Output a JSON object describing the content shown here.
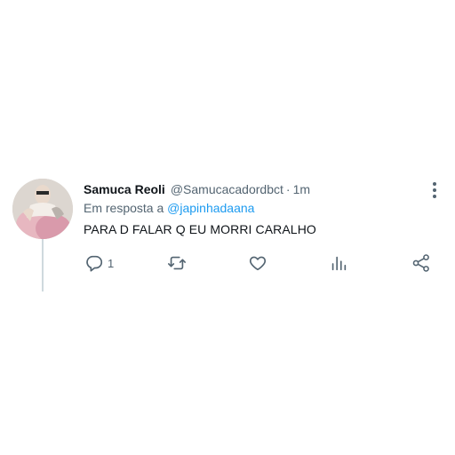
{
  "tweet": {
    "author": {
      "display_name": "Samuca Reoli",
      "handle": "@Samucacadordbct",
      "separator": "·",
      "timestamp": "1m",
      "avatar_icon": "profile-photo"
    },
    "reply_to": {
      "prefix": "Em resposta a",
      "mention": "@japinhadaana"
    },
    "text": "PARA D FALAR Q EU MORRI CARALHO",
    "actions": {
      "reply": {
        "icon": "reply-icon",
        "count": "1"
      },
      "retweet": {
        "icon": "retweet-icon"
      },
      "like": {
        "icon": "heart-icon"
      },
      "analytics": {
        "icon": "analytics-icon"
      },
      "share": {
        "icon": "share-icon"
      }
    },
    "menu": {
      "icon": "more-vertical-icon"
    }
  },
  "colors": {
    "text_primary": "#0f1419",
    "text_secondary": "#536471",
    "link": "#1d9bf0",
    "thread_line": "#cfd9de",
    "background": "#ffffff"
  }
}
